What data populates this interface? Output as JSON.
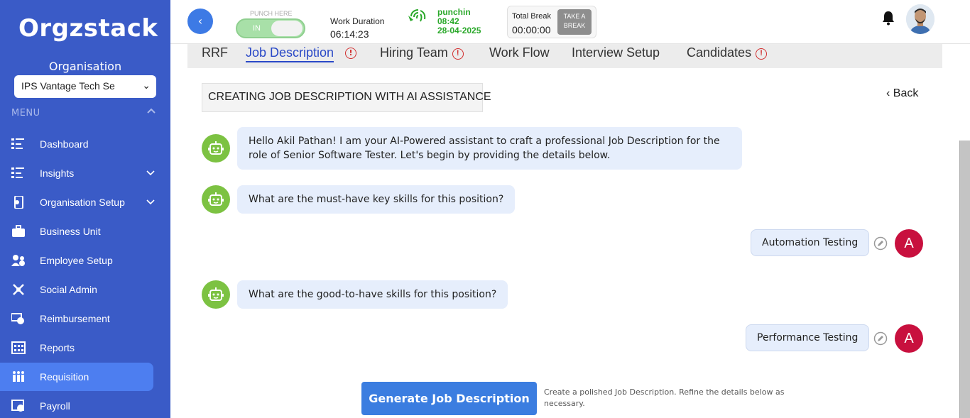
{
  "app": {
    "logo": "Orgzstack"
  },
  "sidebar": {
    "org_label": "Organisation",
    "org_select": "IPS Vantage Tech Se",
    "menu_label": "MENU",
    "items": [
      {
        "label": "Dashboard",
        "icon": "dashboard-icon"
      },
      {
        "label": "Insights",
        "icon": "insights-icon"
      },
      {
        "label": "Organisation Setup",
        "icon": "organisation-setup-icon"
      },
      {
        "label": "Business Unit",
        "icon": "briefcase-icon"
      },
      {
        "label": "Employee Setup",
        "icon": "employee-setup-icon"
      },
      {
        "label": "Social Admin",
        "icon": "social-admin-icon"
      },
      {
        "label": "Reimbursement",
        "icon": "reimbursement-icon"
      },
      {
        "label": "Reports",
        "icon": "reports-icon"
      },
      {
        "label": "Requisition",
        "icon": "requisition-icon",
        "active": true
      },
      {
        "label": "Payroll",
        "icon": "payroll-icon"
      }
    ]
  },
  "header": {
    "punch_label": "PUNCH HERE",
    "toggle_label": "IN",
    "work_duration_label": "Work Duration",
    "work_duration_value": "06:14:23",
    "punch_status": "punchin",
    "punch_time": "08:42",
    "punch_date": "28-04-2025",
    "total_break_label": "Total Break",
    "total_break_value": "00:00:00",
    "take_break_line1": "TAKE A",
    "take_break_line2": "BREAK"
  },
  "tabs": [
    {
      "label": "RRF"
    },
    {
      "label": "Job Description",
      "active": true,
      "alert": "!"
    },
    {
      "label": "Hiring Team",
      "alert": "!"
    },
    {
      "label": "Work Flow"
    },
    {
      "label": "Interview Setup"
    },
    {
      "label": "Candidates",
      "alert": "!"
    }
  ],
  "content": {
    "heading": "CREATING JOB DESCRIPTION WITH AI ASSISTANCE",
    "back_label": "Back",
    "messages": {
      "bot_1": "Hello Akil Pathan! I am your AI-Powered assistant to craft a professional Job Description for the role of Senior Software Tester. Let's begin by providing the details below.",
      "bot_2": "What are the must-have key skills for this position?",
      "user_1": "Automation Testing",
      "bot_3": "What are the good-to-have skills for this position?",
      "user_2": "Performance Testing"
    },
    "user_initial": "A",
    "generate_button": "Generate Job Description",
    "generate_note": "Create a polished Job Description. Refine the details below as necessary."
  },
  "colors": {
    "sidebar_bg": "#3a5bc7",
    "active_item": "#4d7ef0",
    "primary_button": "#3b7de0",
    "bot_avatar": "#7cc242",
    "user_avatar": "#c8103e",
    "alert": "#d23030",
    "punch_green": "#2aa82a"
  }
}
